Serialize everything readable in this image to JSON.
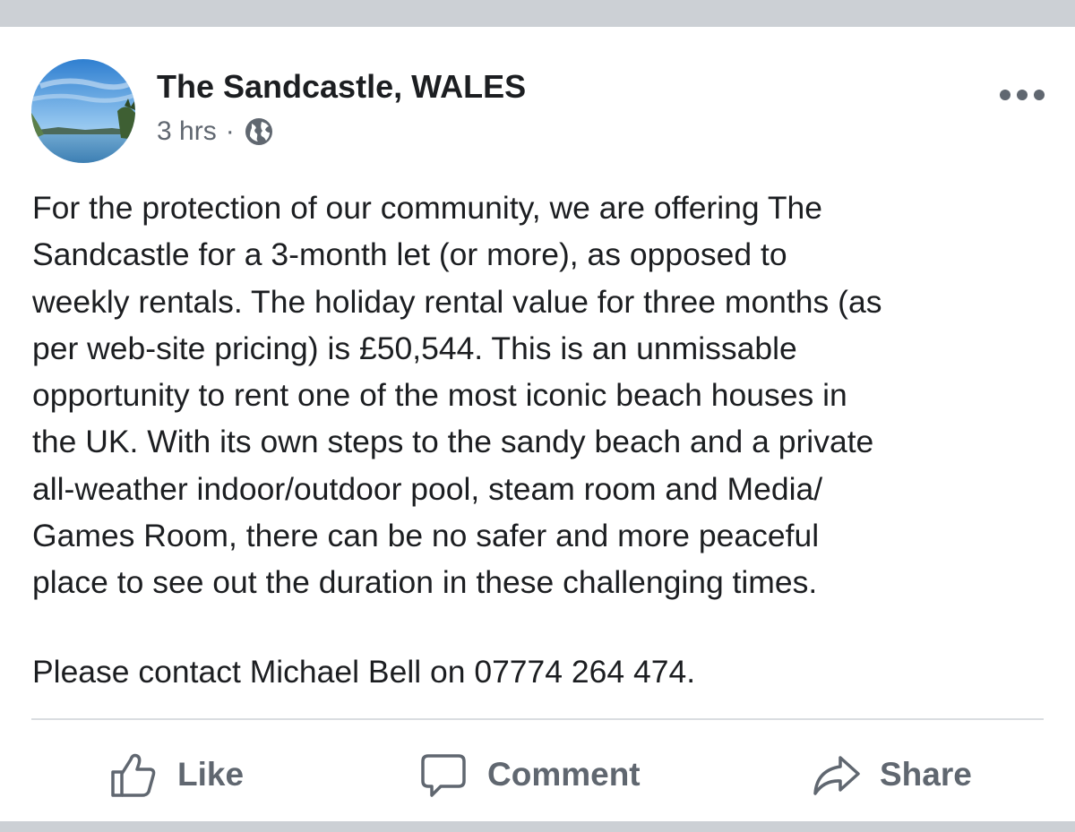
{
  "post": {
    "page_name": "The Sandcastle, WALES",
    "timestamp": "3 hrs",
    "separator": "·",
    "privacy_icon": "globe-icon",
    "more_icon": "more-options-icon",
    "body": "For the protection of our community, we are offering The\nSandcastle for a  3-month let (or more), as opposed to\nweekly rentals. The holiday rental value for three months (as\nper web-site pricing) is £50,544. This is an unmissable\nopportunity to rent one of the most iconic beach houses in\nthe UK. With its own steps to the sandy beach and a private\nall-weather indoor/outdoor pool, steam room and Media/\nGames Room, there can be no safer and more peaceful\nplace to see out the duration in these challenging times.",
    "contact": "Please contact Michael Bell on 07774 264 474."
  },
  "actions": {
    "like_label": "Like",
    "comment_label": "Comment",
    "share_label": "Share"
  },
  "colors": {
    "background": "#ccd0d5",
    "card": "#ffffff",
    "text": "#1c1e21",
    "secondary_text": "#606770",
    "divider": "#dadde1"
  }
}
